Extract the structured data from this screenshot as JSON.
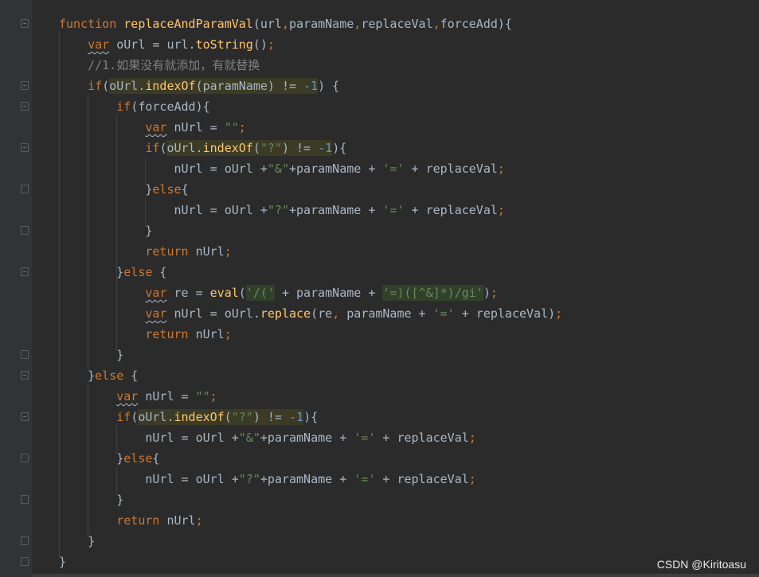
{
  "editor": {
    "lines": [
      "function replaceAndParamVal(url,paramName,replaceVal,forceAdd){",
      "    var oUrl = url.toString();",
      "    //1.如果没有就添加，有就替换",
      "    if(oUrl.indexOf(paramName) != -1) {",
      "        if(forceAdd){",
      "            var nUrl = \"\";",
      "            if(oUrl.indexOf(\"?\") != -1){",
      "                nUrl = oUrl +\"&\"+paramName + '=' + replaceVal;",
      "            }else{",
      "                nUrl = oUrl +\"?\"+paramName + '=' + replaceVal;",
      "            }",
      "            return nUrl;",
      "        }else {",
      "            var re = eval('/(' + paramName + '=)([^&]*)/gi');",
      "            var nUrl = oUrl.replace(re, paramName + '=' + replaceVal);",
      "            return nUrl;",
      "        }",
      "    }else {",
      "        var nUrl = \"\";",
      "        if(oUrl.indexOf(\"?\") != -1){",
      "            nUrl = oUrl +\"&\"+paramName + '=' + replaceVal;",
      "        }else{",
      "            nUrl = oUrl +\"?\"+paramName + '=' + replaceVal;",
      "        }",
      "        return nUrl;",
      "    }",
      "}"
    ]
  },
  "watermark": "CSDN @Kiritoasu",
  "colors": {
    "background": "#2b2b2b",
    "keyword": "#cc7832",
    "function": "#ffc66d",
    "string": "#6a8759",
    "number": "#6897bb",
    "comment": "#808080",
    "text": "#a9b7c6"
  }
}
